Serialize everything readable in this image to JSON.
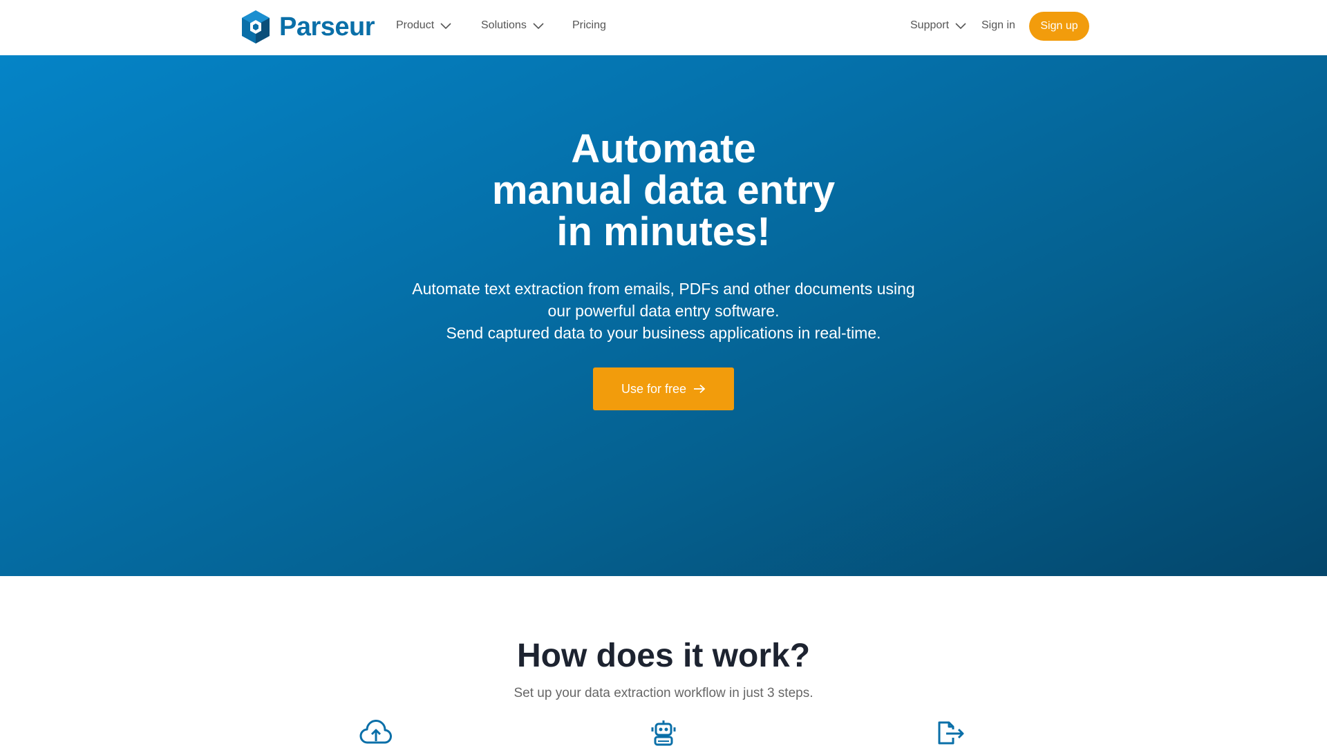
{
  "header": {
    "logo_text": "Parseur",
    "nav": {
      "product": "Product",
      "solutions": "Solutions",
      "pricing": "Pricing",
      "support": "Support",
      "signin": "Sign in",
      "signup": "Sign up"
    }
  },
  "hero": {
    "title_line1": "Automate",
    "title_line2": "manual data entry",
    "title_line3": "in minutes!",
    "sub_line1": "Automate text extraction from emails, PDFs and other documents using",
    "sub_line2": "our powerful data entry software.",
    "sub_line3": "Send captured data to your business applications in real-time.",
    "cta_label": "Use for free"
  },
  "how": {
    "title": "How does it work?",
    "subtitle": "Set up your data extraction workflow in just 3 steps.",
    "step_icons": [
      "cloud-upload-icon",
      "robot-icon",
      "export-file-icon"
    ]
  },
  "colors": {
    "brand_blue": "#0a6fa8",
    "accent_orange": "#f29c0c",
    "hero_gradient_start": "#0584c7",
    "hero_gradient_end": "#04466b",
    "heading_dark": "#1d2330"
  }
}
